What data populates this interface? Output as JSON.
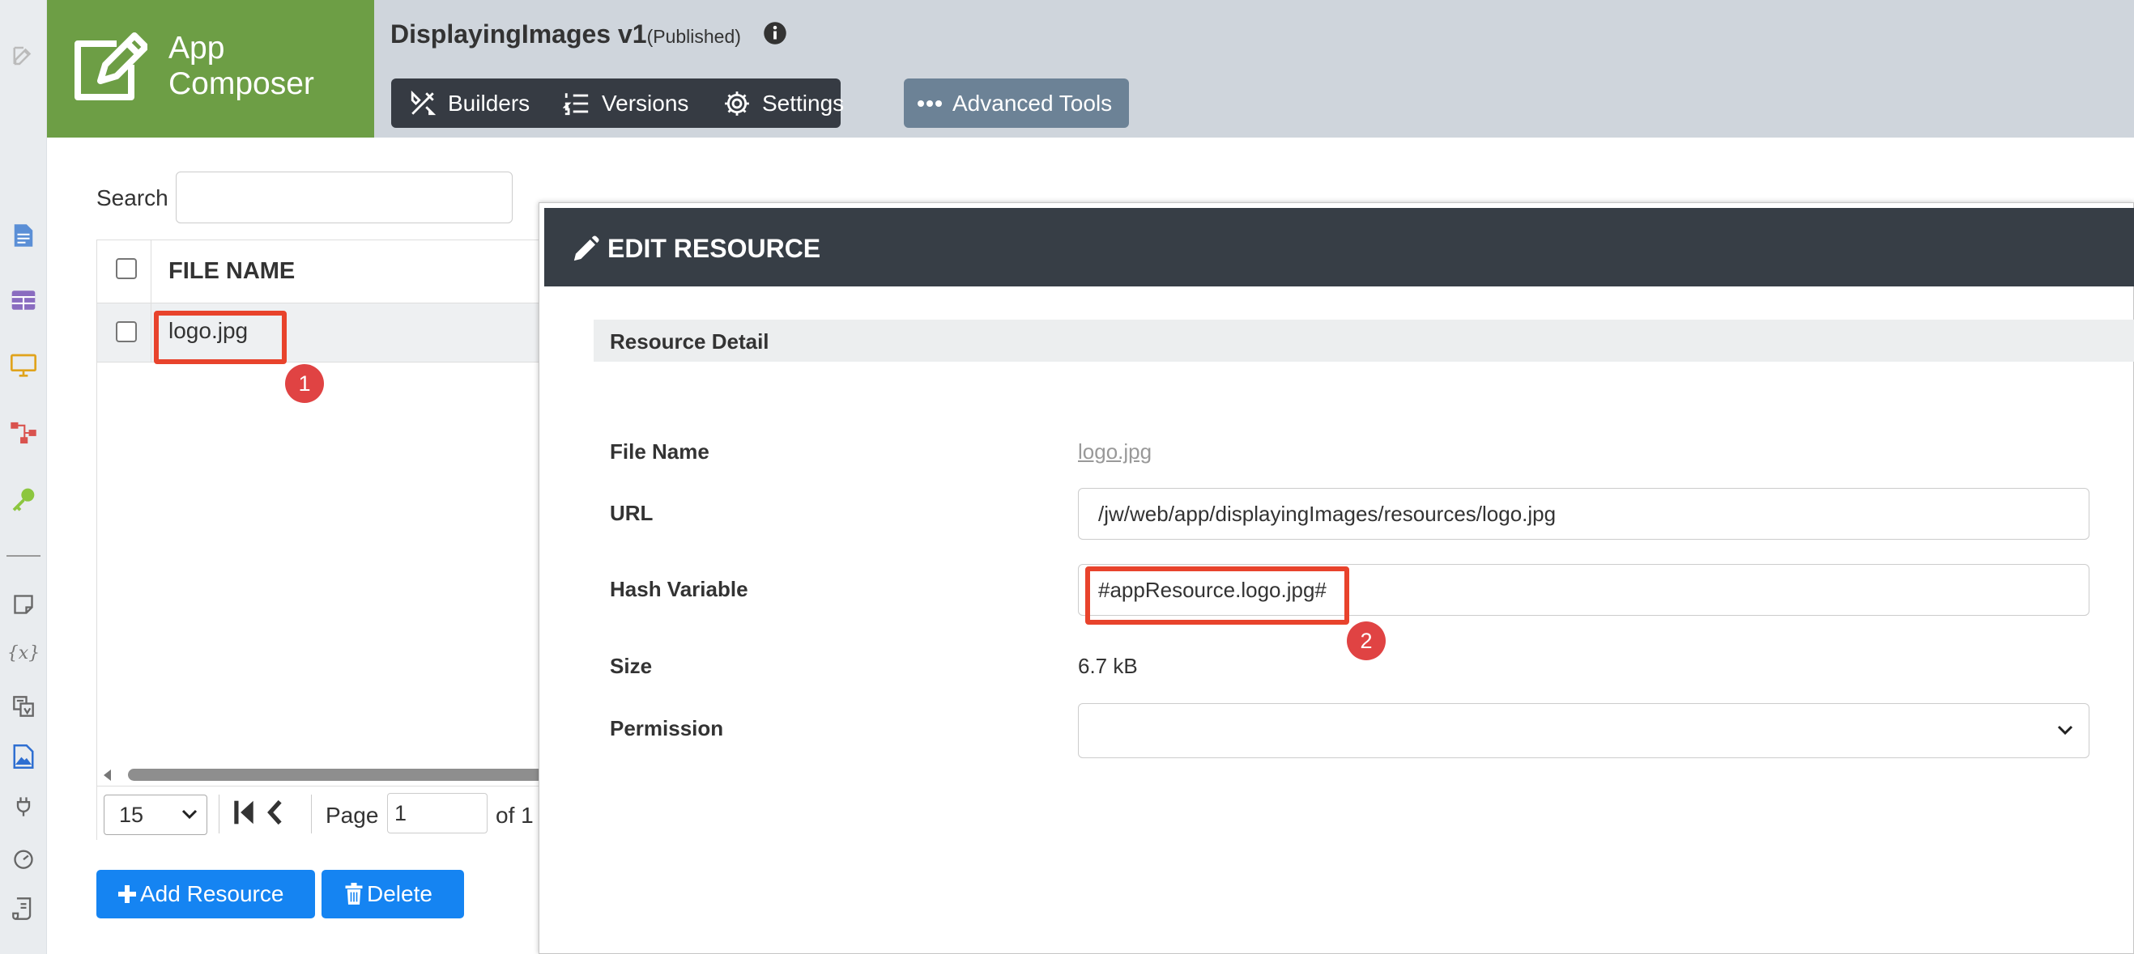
{
  "app": {
    "brand_title": "App Composer",
    "name": "DisplayingImages v1",
    "status": "(Published)"
  },
  "tabs": [
    {
      "label": "Builders",
      "icon": "builder-tools-icon"
    },
    {
      "label": "Versions",
      "icon": "list-icon"
    },
    {
      "label": "Settings",
      "icon": "gear-icon"
    }
  ],
  "advanced_tools": {
    "label": "Advanced Tools",
    "icon": "ellipsis-icon"
  },
  "rail": {
    "icons": [
      "edit-icon",
      "form-icon",
      "datalist-icon",
      "userview-icon",
      "process-icon",
      "key-icon",
      "note-icon",
      "variables-icon",
      "translate-icon",
      "resource-icon",
      "plugin-icon",
      "performance-icon",
      "logs-icon"
    ],
    "vars_glyph": "{x}"
  },
  "search": {
    "label": "Search",
    "value": ""
  },
  "grid": {
    "column_header": "FILE NAME",
    "rows": [
      {
        "file_name": "logo.jpg"
      }
    ]
  },
  "pager": {
    "page_size": "15",
    "page_label": "Page",
    "page_value": "1",
    "of_label": "of 1"
  },
  "buttons": {
    "add_resource": "Add Resource",
    "delete": "Delete"
  },
  "annotations": {
    "badge1": "1",
    "badge2": "2"
  },
  "dialog": {
    "title": "EDIT RESOURCE",
    "section": "Resource Detail",
    "fields": {
      "file_name_label": "File Name",
      "file_name_value": "logo.jpg",
      "url_label": "URL",
      "url_value": "/jw/web/app/displayingImages/resources/logo.jpg",
      "hash_label": "Hash Variable",
      "hash_value": "#appResource.logo.jpg#",
      "size_label": "Size",
      "size_value": "6.7 kB",
      "permission_label": "Permission",
      "permission_value": ""
    }
  },
  "colors": {
    "brand_green": "#6d9e45",
    "topbar": "#cfd5dc",
    "tabbar": "#363b43",
    "advanced_button": "#6c8296",
    "primary_button": "#1584f2",
    "dialog_header": "#373e46",
    "highlight": "#e8432c",
    "badge": "#e04343"
  }
}
